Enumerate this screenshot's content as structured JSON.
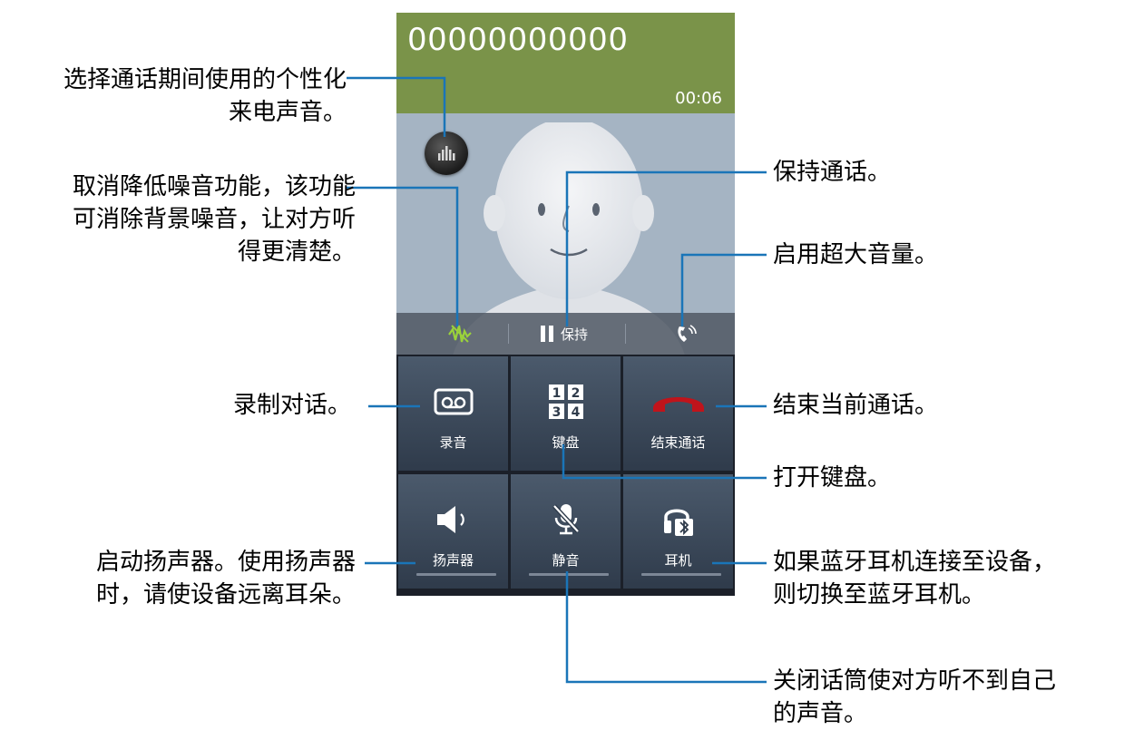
{
  "call": {
    "number": "00000000000",
    "timer": "00:06",
    "hold_label": "保持"
  },
  "tiles": {
    "record": "录音",
    "keypad": "键盘",
    "end_call": "结束通话",
    "speaker": "扬声器",
    "mute": "静音",
    "headset": "耳机"
  },
  "keypad_icon_digits": [
    "1",
    "2",
    "3",
    "4"
  ],
  "annotations": {
    "sound_1": "选择通话期间使用的个性化",
    "sound_2": "来电声音。",
    "noise_1": "取消降低噪音功能，该功能",
    "noise_2": "可消除背景噪音，让对方听",
    "noise_3": "得更清楚。",
    "record": "录制对话。",
    "speaker_1": "启动扬声器。使用扬声器",
    "speaker_2": "时，请使设备远离耳朵。",
    "hold": "保持通话。",
    "extra_volume": "启用超大音量。",
    "end_call": "结束当前通话。",
    "keypad": "打开键盘。",
    "bluetooth_1": "如果蓝牙耳机连接至设备，",
    "bluetooth_2": "则切换至蓝牙耳机。",
    "mute_1": "关闭话筒使对方听不到自己",
    "mute_2": "的声音。"
  },
  "colors": {
    "header_green": "#7a9349",
    "photo_bg": "#a5b4c3",
    "tile_top": "#4b5a6c",
    "end_call_red": "#c0141b",
    "callout_line": "#1a75b8"
  }
}
